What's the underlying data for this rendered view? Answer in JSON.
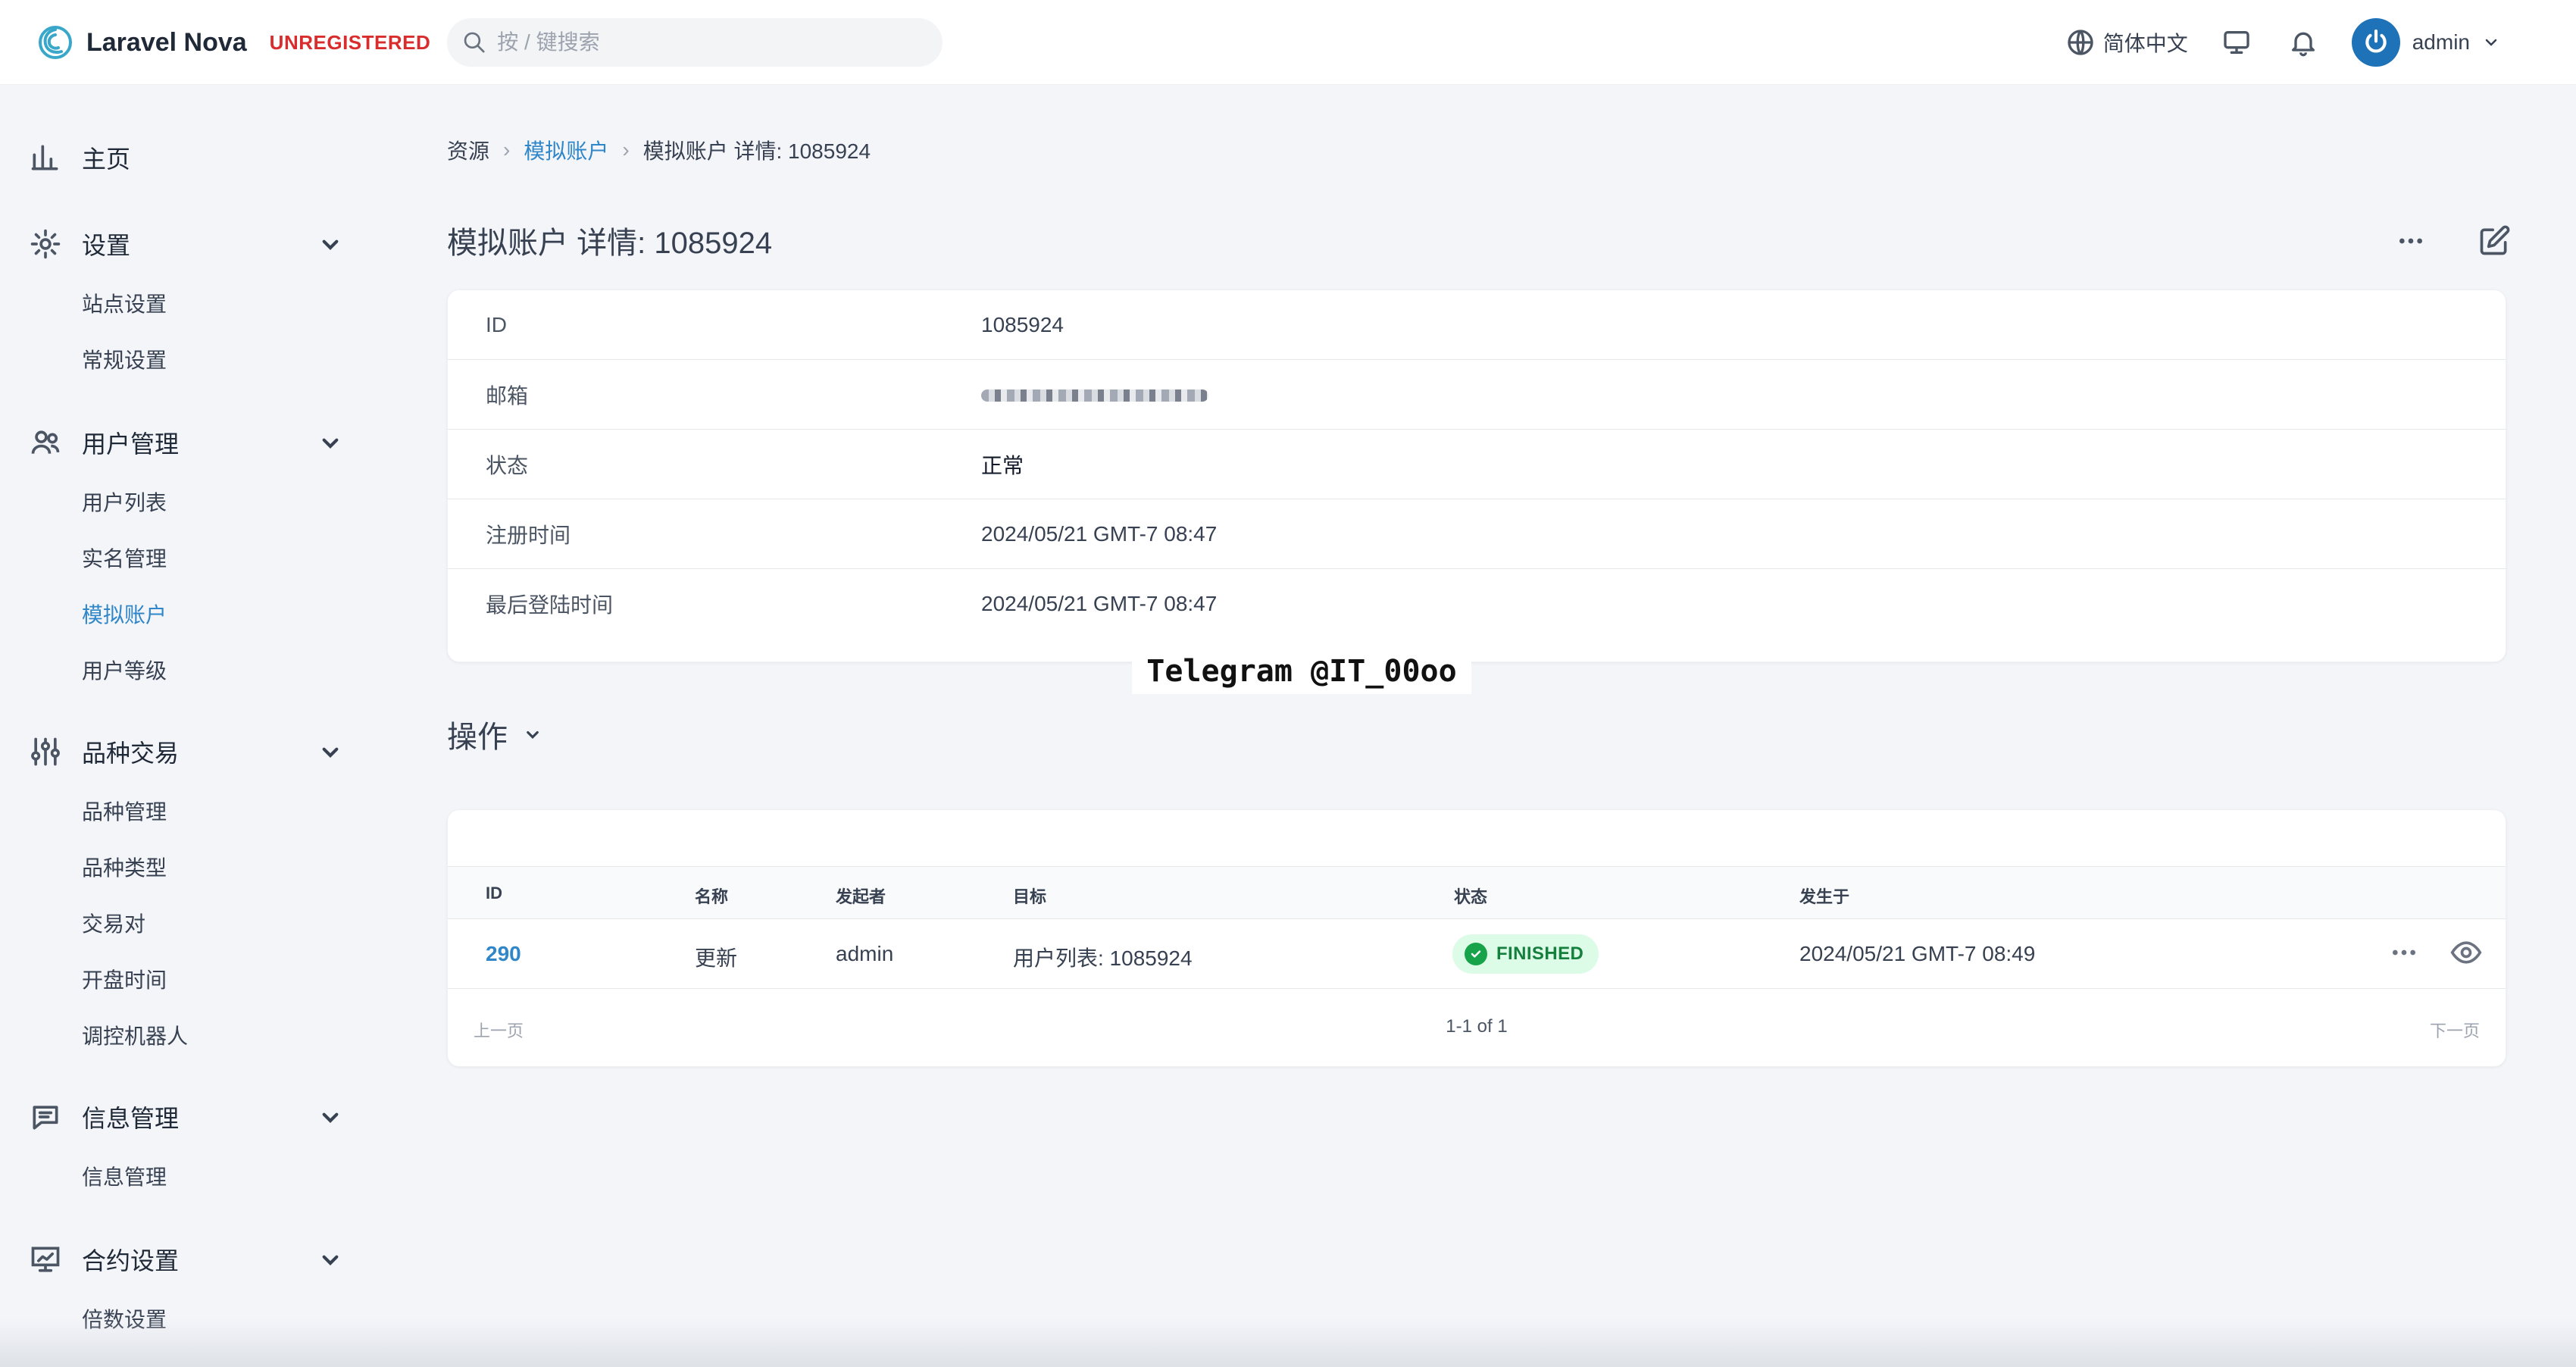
{
  "header": {
    "brand_name": "Laravel Nova",
    "brand_status": "UNREGISTERED",
    "search_placeholder": "按 / 键搜索",
    "language": "简体中文",
    "user_name": "admin"
  },
  "sidebar": {
    "home": "主页",
    "groups": [
      {
        "label": "设置",
        "items": [
          "站点设置",
          "常规设置"
        ]
      },
      {
        "label": "用户管理",
        "items": [
          "用户列表",
          "实名管理",
          "模拟账户",
          "用户等级"
        ]
      },
      {
        "label": "品种交易",
        "items": [
          "品种管理",
          "品种类型",
          "交易对",
          "开盘时间",
          "调控机器人"
        ]
      },
      {
        "label": "信息管理",
        "items": [
          "信息管理"
        ]
      },
      {
        "label": "合约设置",
        "items": [
          "倍数设置"
        ]
      }
    ]
  },
  "breadcrumb": {
    "root": "资源",
    "resource": "模拟账户",
    "current": "模拟账户 详情: 1085924"
  },
  "page": {
    "title": "模拟账户 详情: 1085924"
  },
  "detail": {
    "rows": [
      {
        "label": "ID",
        "value": "1085924"
      },
      {
        "label": "邮箱",
        "value": ""
      },
      {
        "label": "状态",
        "value": "正常"
      },
      {
        "label": "注册时间",
        "value": "2024/05/21 GMT-7 08:47"
      },
      {
        "label": "最后登陆时间",
        "value": "2024/05/21 GMT-7 08:47"
      }
    ]
  },
  "watermark": "Telegram @IT_00oo",
  "actions": {
    "title": "操作",
    "table": {
      "headers": [
        "ID",
        "名称",
        "发起者",
        "目标",
        "状态",
        "发生于"
      ],
      "rows": [
        {
          "id": "290",
          "name": "更新",
          "initiator": "admin",
          "target": "用户列表: 1085924",
          "status": "FINISHED",
          "occurred_at": "2024/05/21 GMT-7 08:49"
        }
      ]
    },
    "pagination": {
      "prev": "上一页",
      "count": "1-1 of 1",
      "next": "下一页"
    }
  },
  "colors": {
    "accent": "#2f86c9",
    "danger": "#d92d2d",
    "success_bg": "#dcfce7",
    "success_text": "#15803d",
    "background": "#f3f5f9"
  },
  "icons": {
    "brand": "laravel-nova-logo",
    "search": "search-icon",
    "language": "globe-icon",
    "display": "monitor-icon",
    "notifications": "bell-icon",
    "avatar": "power-avatar-icon",
    "more": "ellipsis-icon",
    "edit": "edit-icon",
    "view": "eye-icon",
    "chevron": "chevron-down-icon"
  }
}
